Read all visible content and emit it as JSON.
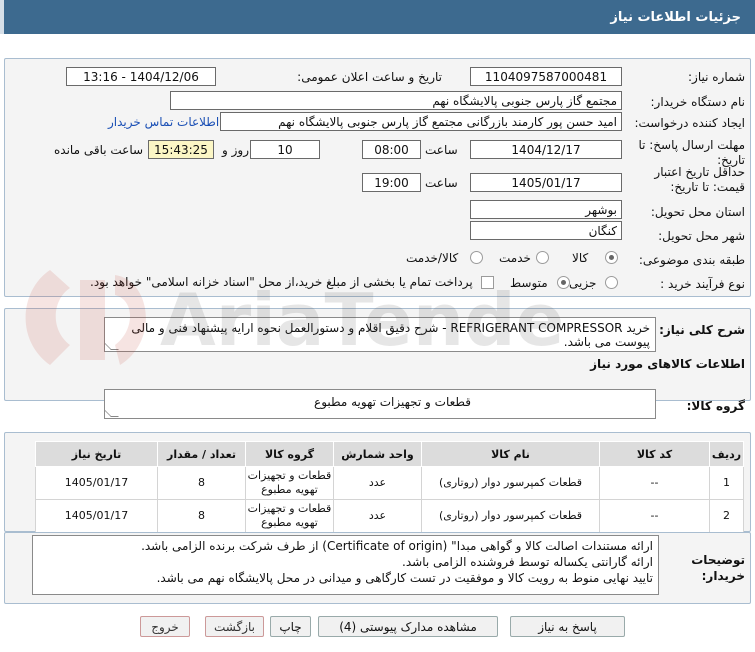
{
  "header": {
    "title": "جزئیات اطلاعات نیاز"
  },
  "form": {
    "need_number_label": "شماره نیاز:",
    "need_number": "1104097587000481",
    "announce_label": "تاریخ و ساعت اعلان عمومی:",
    "announce_value": "1404/12/06 - 13:16",
    "buyer_org_label": "نام دستگاه خریدار:",
    "buyer_org": "مجتمع گاز پارس جنوبی  پالایشگاه نهم",
    "creator_label": "ایجاد کننده درخواست:",
    "creator": "امید حسن پور کارمند بازرگانی مجتمع گاز پارس جنوبی  پالایشگاه نهم",
    "contact_link": "اطلاعات تماس خریدار",
    "reply_deadline_label": "مهلت ارسال پاسخ: تا تاریخ:",
    "reply_date": "1404/12/17",
    "time_label": "ساعت",
    "reply_time": "08:00",
    "days": "10",
    "days_label": "روز و",
    "remaining_time": "15:43:25",
    "remaining_label": "ساعت باقی مانده",
    "price_validity_label": "حداقل تاریخ اعتبار قیمت: تا تاریخ:",
    "validity_date": "1405/01/17",
    "validity_time": "19:00",
    "province_label": "استان محل تحویل:",
    "province": "بوشهر",
    "city_label": "شهر محل تحویل:",
    "city": "کنگان",
    "category_label": "طبقه بندی موضوعی:",
    "category_options": [
      "کالا",
      "خدمت",
      "کالا/خدمت"
    ],
    "process_label": "نوع فرآیند خرید :",
    "process_options": [
      "جزیی",
      "متوسط"
    ],
    "payment_note": "پرداخت تمام یا بخشی از مبلغ خرید،از محل \"اسناد خزانه اسلامی\" خواهد بود."
  },
  "description": {
    "label": "شرح کلی نیاز:",
    "text": "خرید REFRIGERANT COMPRESSOR - شرح دقیق اقلام و دستورالعمل نحوه ارایه پیشنهاد فنی و مالی پیوست می باشد."
  },
  "goods": {
    "section_title": "اطلاعات کالاهای مورد نیاز",
    "group_label": "گروه کالا:",
    "group_value": "قطعات و تجهیزات تهویه مطبوع",
    "columns": [
      "ردیف",
      "کد کالا",
      "نام کالا",
      "واحد شمارش",
      "گروه کالا",
      "تعداد / مقدار",
      "تاریخ نیاز"
    ],
    "rows": [
      {
        "row": "1",
        "code": "--",
        "name": "قطعات کمپرسور دوار (روتاری)",
        "unit": "عدد",
        "group": "قطعات و تجهیزات تهویه مطبوع",
        "qty": "8",
        "date": "1405/01/17"
      },
      {
        "row": "2",
        "code": "--",
        "name": "قطعات کمپرسور دوار (روتاری)",
        "unit": "عدد",
        "group": "قطعات و تجهیزات تهویه مطبوع",
        "qty": "8",
        "date": "1405/01/17"
      }
    ]
  },
  "buyer_notes": {
    "label": "توضیحات خریدار:",
    "lines": [
      "ارائه مستندات اصالت کالا و گواهی مبدا\" (Certificate of origin) از طرف شرکت برنده الزامی باشد.",
      "ارائه گارانتی یکساله توسط فروشنده الزامی باشد.",
      "تایید نهایی منوط به رویت کالا و موفقیت در تست کارگاهی و  میدانی در محل پالایشگاه نهم می باشد."
    ]
  },
  "buttons": {
    "reply": "پاسخ به نیاز",
    "attachments": "مشاهده مدارک پیوستی (4)",
    "print": "چاپ",
    "back": "بازگشت",
    "exit": "خروج"
  },
  "watermark": {
    "text": "AriaTender.neT"
  },
  "colors": {
    "header": "#3d6a8f",
    "accent_link": "#1a4fb5",
    "remaining_bg": "#fbf6c5"
  }
}
